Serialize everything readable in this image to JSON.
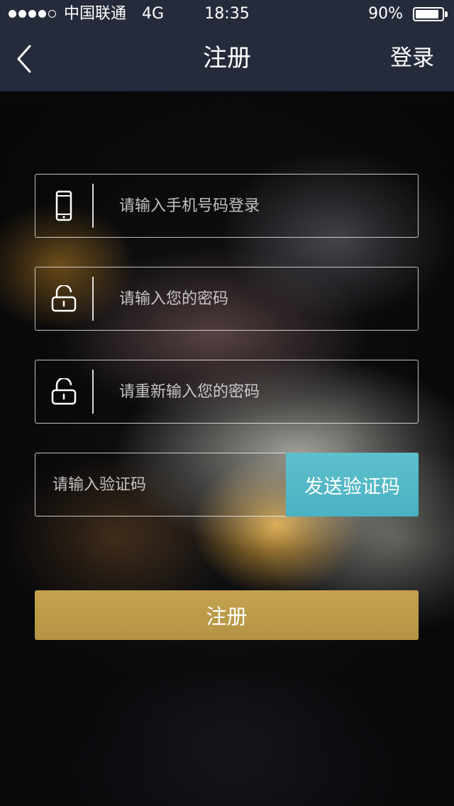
{
  "status_bar": {
    "carrier": "中国联通",
    "network": "4G",
    "time": "18:35",
    "battery_percent": "90%",
    "battery_level": 0.9,
    "signal_bars": 4,
    "signal_max": 5
  },
  "nav": {
    "title": "注册",
    "login_label": "登录",
    "back_icon": "chevron-left-icon"
  },
  "form": {
    "phone": {
      "placeholder": "请输入手机号码登录",
      "value": "",
      "icon": "phone-icon"
    },
    "password": {
      "placeholder": "请输入您的密码",
      "value": "",
      "icon": "lock-icon"
    },
    "password_confirm": {
      "placeholder": "请重新输入您的密码",
      "value": "",
      "icon": "lock-icon"
    },
    "verification_code": {
      "placeholder": "请输入验证码",
      "value": ""
    },
    "send_code_label": "发送验证码",
    "submit_label": "注册"
  },
  "colors": {
    "nav_background": "#252b3a",
    "send_code_button": "#55b9c7",
    "register_button": "#bc9b48"
  }
}
